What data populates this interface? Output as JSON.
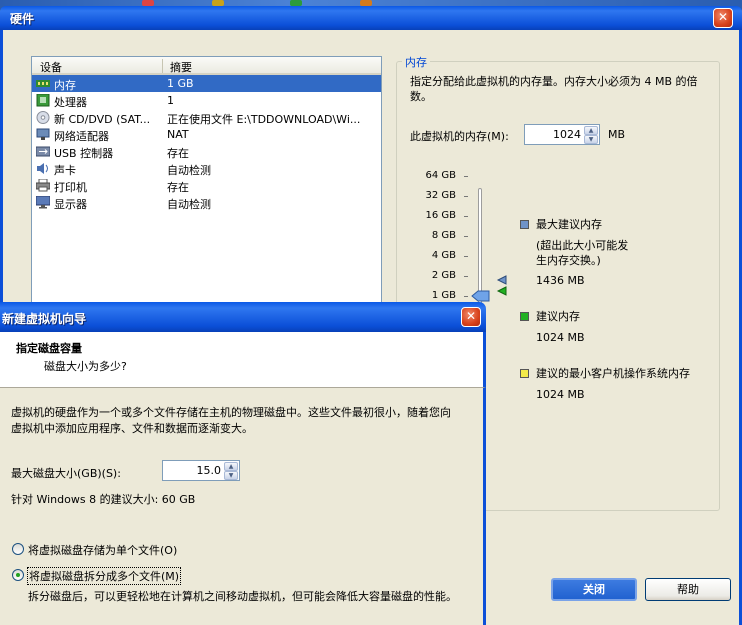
{
  "hardware_dialog": {
    "title": "硬件",
    "device_list": {
      "col_device": "设备",
      "col_summary": "摘要",
      "rows": [
        {
          "name": "内存",
          "summary": "1 GB",
          "icon": "memory-icon"
        },
        {
          "name": "处理器",
          "summary": "1",
          "icon": "processor-icon"
        },
        {
          "name": "新 CD/DVD (SAT...",
          "summary": "正在使用文件 E:\\TDDOWNLOAD\\Wi...",
          "icon": "cd-dvd-icon"
        },
        {
          "name": "网络适配器",
          "summary": "NAT",
          "icon": "network-adapter-icon"
        },
        {
          "name": "USB 控制器",
          "summary": "存在",
          "icon": "usb-icon"
        },
        {
          "name": "声卡",
          "summary": "自动检测",
          "icon": "sound-card-icon"
        },
        {
          "name": "打印机",
          "summary": "存在",
          "icon": "printer-icon"
        },
        {
          "name": "显示器",
          "summary": "自动检测",
          "icon": "display-icon"
        }
      ]
    },
    "memory": {
      "group_title": "内存",
      "description": "指定分配给此虚拟机的内存量。内存大小必须为 4 MB 的倍数。",
      "label": "此虚拟机的内存(M):",
      "value": "1024",
      "unit": "MB",
      "scale": [
        "64 GB",
        "32 GB",
        "16 GB",
        "8 GB",
        "4 GB",
        "2 GB",
        "1 GB"
      ],
      "max_recommended": {
        "label": "最大建议内存",
        "note": "(超出此大小可能发生内存交换。)",
        "value": "1436 MB",
        "color": "#6f93c8"
      },
      "recommended": {
        "label": "建议内存",
        "value": "1024 MB",
        "color": "#22b022"
      },
      "min_guest": {
        "label": "建议的最小客户机操作系统内存",
        "value": "1024 MB",
        "color": "#f2ea4a"
      }
    },
    "buttons": {
      "close": "关闭",
      "help": "帮助"
    }
  },
  "wizard": {
    "title": "新建虚拟机向导",
    "heading": "指定磁盘容量",
    "subheading": "磁盘大小为多少?",
    "description": "虚拟机的硬盘作为一个或多个文件存储在主机的物理磁盘中。这些文件最初很小，随着您向虚拟机中添加应用程序、文件和数据而逐渐变大。",
    "max_disk_label": "最大磁盘大小(GB)(S):",
    "max_disk_value": "15.0",
    "recommended_size": "针对 Windows 8 的建议大小: 60 GB",
    "options": [
      {
        "label": "将虚拟磁盘存储为单个文件(O)",
        "selected": false
      },
      {
        "label": "将虚拟磁盘拆分成多个文件(M)",
        "selected": true
      }
    ],
    "split_note": "拆分磁盘后，可以更轻松地在计算机之间移动虚拟机，但可能会降低大容量磁盘的性能。"
  }
}
